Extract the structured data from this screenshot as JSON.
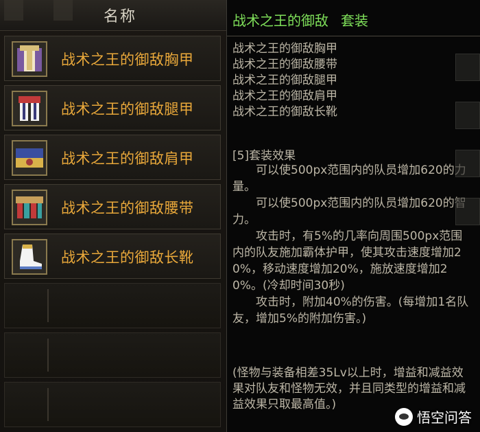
{
  "list": {
    "header": "名称",
    "items": [
      {
        "name": "战术之王的御敌胸甲",
        "icon": "chest-armor-icon",
        "colors": [
          "#d9c07a",
          "#7a5aa0",
          "#f1e6c8"
        ]
      },
      {
        "name": "战术之王的御敌腿甲",
        "icon": "leg-armor-icon",
        "colors": [
          "#c23a3a",
          "#f3f3f3",
          "#3a3a7a"
        ]
      },
      {
        "name": "战术之王的御敌肩甲",
        "icon": "shoulder-armor-icon",
        "colors": [
          "#d9b24a",
          "#3a4fa0",
          "#a03a3a"
        ]
      },
      {
        "name": "战术之王的御敌腰带",
        "icon": "belt-icon",
        "colors": [
          "#c8a05a",
          "#3aa0a0",
          "#c23a3a"
        ]
      },
      {
        "name": "战术之王的御敌长靴",
        "icon": "boots-icon",
        "colors": [
          "#f3f3f3",
          "#d9b24a",
          "#5a7ac2"
        ]
      }
    ],
    "item_name_color": "#e9a83a"
  },
  "tooltip": {
    "set_name": "战术之王的御敌",
    "set_tag": "套装",
    "title_color": "#7fe05a",
    "pieces": [
      "战术之王的御敌胸甲",
      "战术之王的御敌腰带",
      "战术之王的御敌腿甲",
      "战术之王的御敌肩甲",
      "战术之王的御敌长靴"
    ],
    "bonus_header": "[5]套装效果",
    "effects": [
      "可以使500px范围内的队员增加620的力量。",
      "可以使500px范围内的队员增加620的智力。",
      "攻击时，有5%的几率向周围500px范围内的队友施加霸体护甲，使其攻击速度增加20%，移动速度增加20%，施放速度增加20%。(冷却时间30秒)",
      "攻击时，附加40%的伤害。(每增加1名队友，增加5%的附加伤害。)"
    ],
    "note": "(怪物与装备相差35Lv以上时，增益和减益效果对队友和怪物无效，并且同类型的增益和减益效果只取最高值。)"
  },
  "watermark": {
    "text": "悟空问答"
  }
}
